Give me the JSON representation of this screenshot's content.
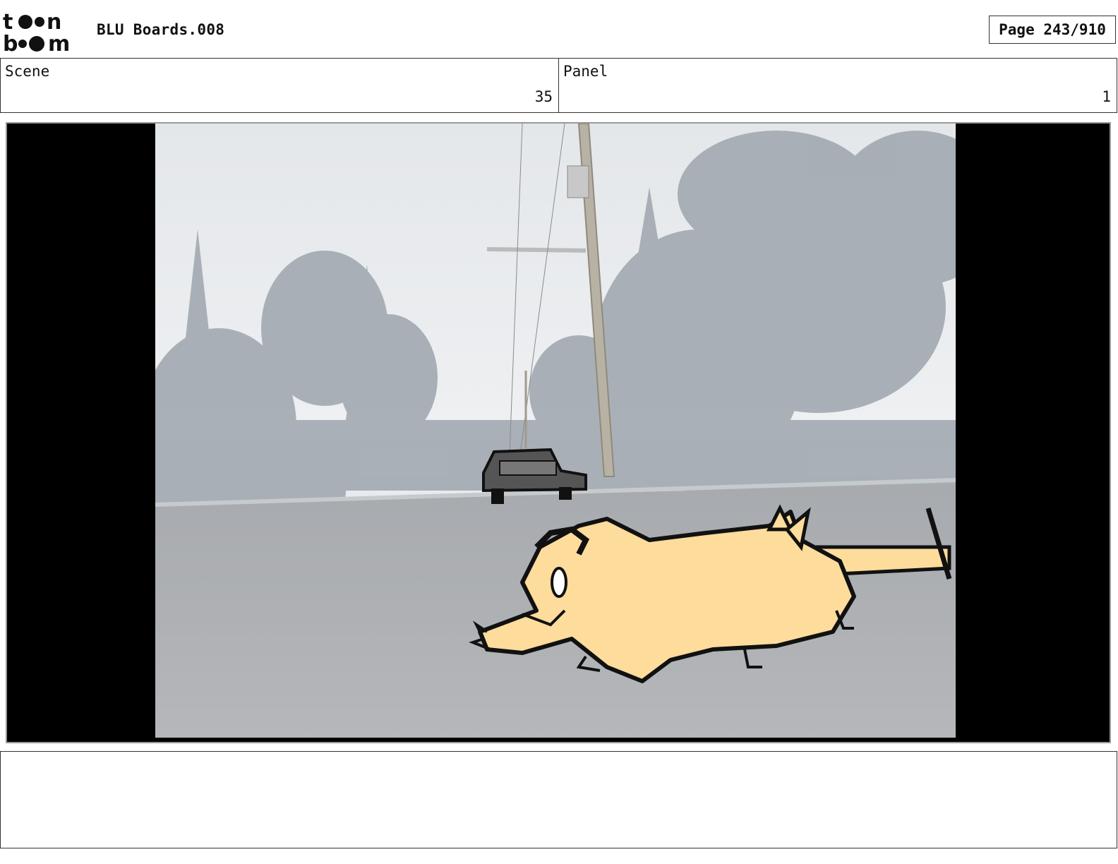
{
  "header": {
    "logo_alt": "toon boom",
    "title": "BLU Boards.008",
    "page": "Page 243/910"
  },
  "info": {
    "scene_label": "Scene",
    "scene_value": "35",
    "panel_label": "Panel",
    "panel_value": "1"
  },
  "panel_image": {
    "description_icon": "storyboard-panel-image",
    "bg_color": "#c9cdd2",
    "character_color": "#fddc9c"
  },
  "notes": {
    "text": ""
  }
}
